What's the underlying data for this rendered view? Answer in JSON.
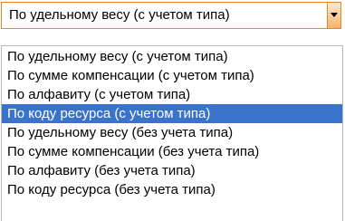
{
  "combo": {
    "value": "По удельному весу (с учетом типа)",
    "arrow_icon": "dropdown-arrow-icon"
  },
  "dropdown": {
    "selected_index": 3,
    "options": [
      "По удельному весу (с учетом типа)",
      "По сумме компенсации (с учетом типа)",
      "По алфавиту (с учетом типа)",
      "По коду ресурса (с учетом типа)",
      "По удельному весу (без учета типа)",
      "По сумме компенсации (без учета типа)",
      "По алфавиту (без учета типа)",
      "По коду ресурса (без учета типа)"
    ]
  },
  "colors": {
    "selection": "#3a73cc",
    "combo_border": "#e5862a"
  }
}
